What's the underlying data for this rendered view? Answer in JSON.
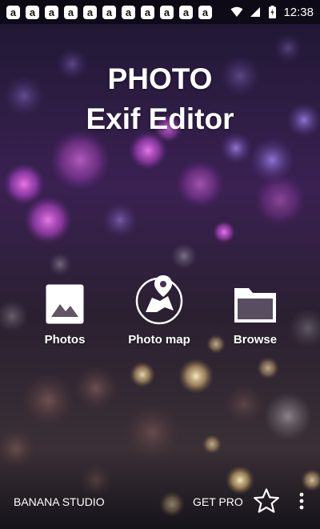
{
  "status_bar": {
    "notification_icons": [
      "a",
      "a",
      "a",
      "a",
      "a",
      "a",
      "a",
      "a",
      "a",
      "a",
      "a",
      "a"
    ],
    "notification_icon_name": "app-notification-icon",
    "time": "12:38"
  },
  "title": {
    "line1": "PHOTO",
    "line2": "Exif Editor"
  },
  "actions": [
    {
      "label": "Photos",
      "icon": "image-icon"
    },
    {
      "label": "Photo map",
      "icon": "map-pin-icon"
    },
    {
      "label": "Browse",
      "icon": "folder-icon"
    }
  ],
  "bottom": {
    "studio": "BANANA STUDIO",
    "get_pro": "GET PRO"
  },
  "colors": {
    "text": "#ffffff",
    "background": "#17131f",
    "bokeh_purple": "#b04ad8",
    "bokeh_gold": "#e8c47a"
  }
}
